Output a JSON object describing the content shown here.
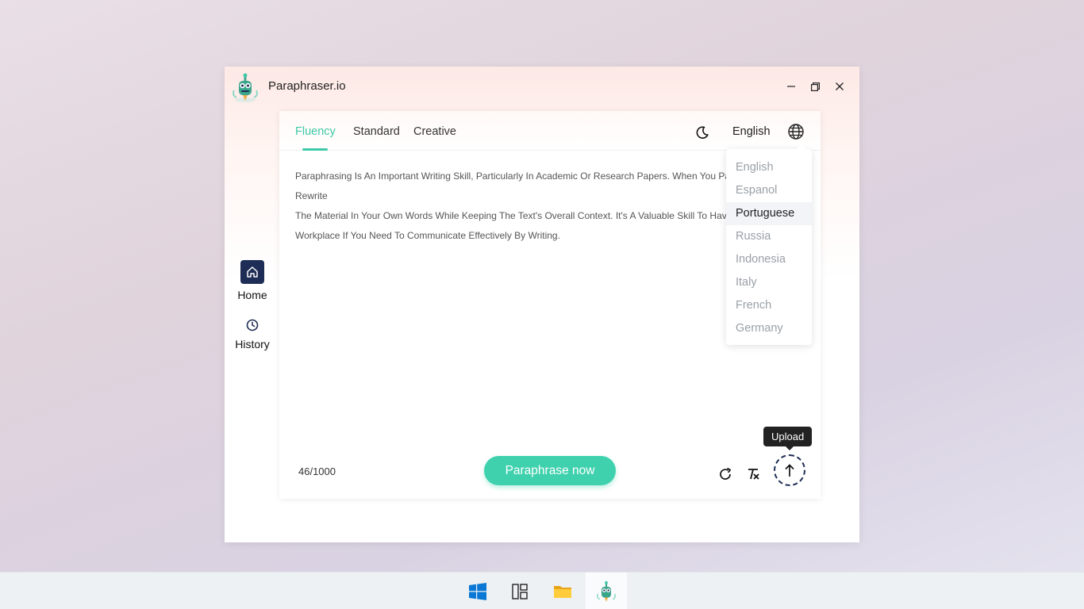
{
  "window": {
    "title": "Paraphraser.io",
    "controls": [
      "minimize",
      "restore",
      "close"
    ]
  },
  "sidebar": {
    "items": [
      {
        "label": "Home",
        "icon": "home-icon",
        "active": true
      },
      {
        "label": "History",
        "icon": "clock-icon",
        "active": false
      }
    ]
  },
  "editor": {
    "tabs": [
      {
        "label": "Fluency",
        "active": true
      },
      {
        "label": "Standard",
        "active": false
      },
      {
        "label": "Creative",
        "active": false
      }
    ],
    "language": "English",
    "text_lines": [
      "Paraphrasing Is An Important Writing Skill, Particularly In Academic Or Research Papers. When You Paraphrase, You",
      "Rewrite",
      "The Material In Your Own Words While Keeping The Text's Overall Context. It's A Valuable Skill To Have In The",
      "Workplace If You Need To Communicate Effectively By Writing."
    ],
    "counter": "46/1000",
    "paraphrase_label": "Paraphrase now",
    "upload_tooltip": "Upload"
  },
  "language_dropdown": {
    "options": [
      "English",
      "Espanol",
      "Portuguese",
      "Russia",
      "Indonesia",
      "Italy",
      "French",
      "Germany"
    ],
    "highlighted": "Portuguese"
  },
  "taskbar": {
    "items": [
      "windows-start-icon",
      "task-view-icon",
      "file-explorer-icon",
      "paraphraser-app-icon"
    ]
  },
  "colors": {
    "accent": "#3ec9a7",
    "button": "#3fd1ad",
    "navy": "#1e2d55"
  }
}
